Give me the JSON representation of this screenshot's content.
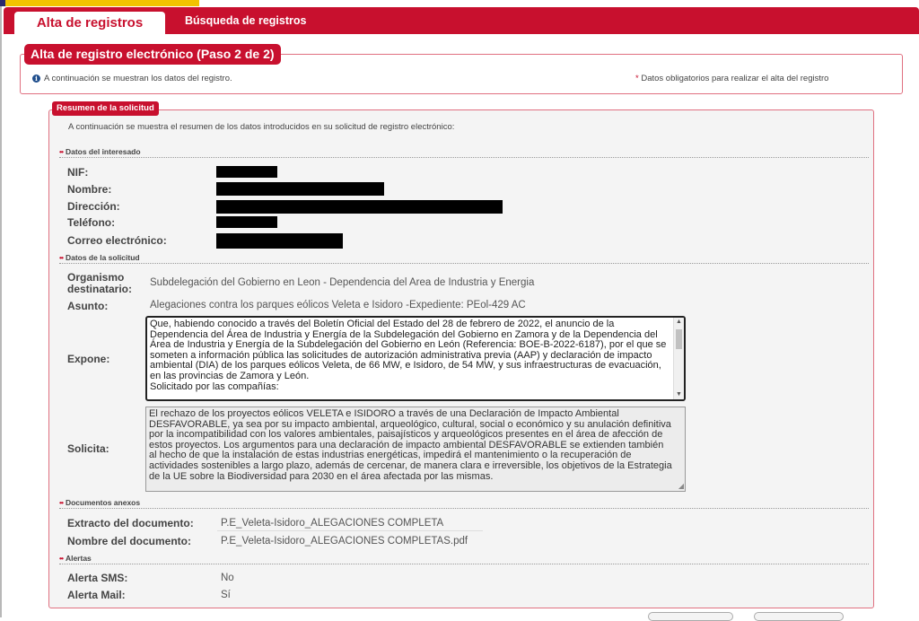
{
  "tabs": {
    "active": "Alta de registros",
    "inactive": "Búsqueda de registros"
  },
  "step": {
    "title": "Alta de registro electrónico (Paso 2 de 2)",
    "info": "A continuación se muestran los datos del registro.",
    "required_asterisk": "*",
    "required_note": "Datos obligatorios para realizar el alta del registro"
  },
  "summary": {
    "title": "Resumen de la solicitud",
    "intro": "A continuación se muestra el resumen de los datos introducidos en su solicitud de registro electrónico:"
  },
  "section_marker": "••",
  "interesado": {
    "heading": "Datos del interesado",
    "nif_label": "NIF:",
    "nombre_label": "Nombre:",
    "direccion_label": "Dirección:",
    "telefono_label": "Teléfono:",
    "correo_label": "Correo electrónico:"
  },
  "solicitud": {
    "heading": "Datos de la solicitud",
    "organismo_label_1": "Organismo",
    "organismo_label_2": "destinatario:",
    "organismo_value": "Subdelegación del Gobierno en Leon - Dependencia del Area de Industria y Energia",
    "asunto_label": "Asunto:",
    "asunto_value": "Alegaciones contra los parques eólicos Veleta e Isidoro -Expediente: PEol-429 AC",
    "expone_label": "Expone:",
    "expone_text": "Que, habiendo conocido a través del Boletín Oficial del Estado del 28 de febrero de 2022, el anuncio de la Dependencia del Área de Industria y Energía de la Subdelegación del Gobierno en Zamora y de la Dependencia del Área de Industria y Energía de la Subdelegación del Gobierno en León (Referencia: BOE-B-2022-6187), por el que se someten a información pública las solicitudes de autorización administrativa previa (AAP) y declaración de impacto ambiental (DIA) de los parques eólicos Veleta, de 66 MW, e Isidoro, de 54 MW, y sus infraestructuras de evacuación, en las provincias de Zamora y León.\nSolicitado por las compañías:",
    "solicita_label": "Solicita:",
    "solicita_text": "El rechazo de los proyectos eólicos VELETA e ISIDORO a través de una Declaración de Impacto Ambiental DESFAVORABLE, ya sea por su impacto ambiental, arqueológico, cultural, social o económico y su anulación definitiva por la incompatibilidad con los valores ambientales, paisajísticos y arqueológicos presentes en el área de afección de estos proyectos. Los argumentos para una declaración de impacto ambiental DESFAVORABLE se extienden también al hecho de que la instalación de estas industrias energéticas, impedirá el mantenimiento o la recuperación de actividades sostenibles a largo plazo, además de cercenar, de manera clara e irreversible, los objetivos de la Estrategia de la UE sobre la Biodiversidad para 2030 en el área afectada por las mismas."
  },
  "documentos": {
    "heading": "Documentos anexos",
    "extracto_label": "Extracto del documento:",
    "extracto_value": "P.E_Veleta-Isidoro_ALEGACIONES COMPLETA",
    "nombre_label": "Nombre del documento:",
    "nombre_value": "P.E_Veleta-Isidoro_ALEGACIONES COMPLETAS.pdf"
  },
  "alertas": {
    "heading": "Alertas",
    "sms_label": "Alerta SMS:",
    "sms_value": "No",
    "mail_label": "Alerta Mail:",
    "mail_value": "Sí"
  },
  "icons": {
    "info": "info-icon",
    "scroll_up": "▲",
    "scroll_down": "▼",
    "resize_grip": "◢"
  },
  "colors": {
    "brand_red": "#c8102e",
    "flag_yellow": "#f2c300",
    "flag_blue": "#2a2a6e"
  }
}
